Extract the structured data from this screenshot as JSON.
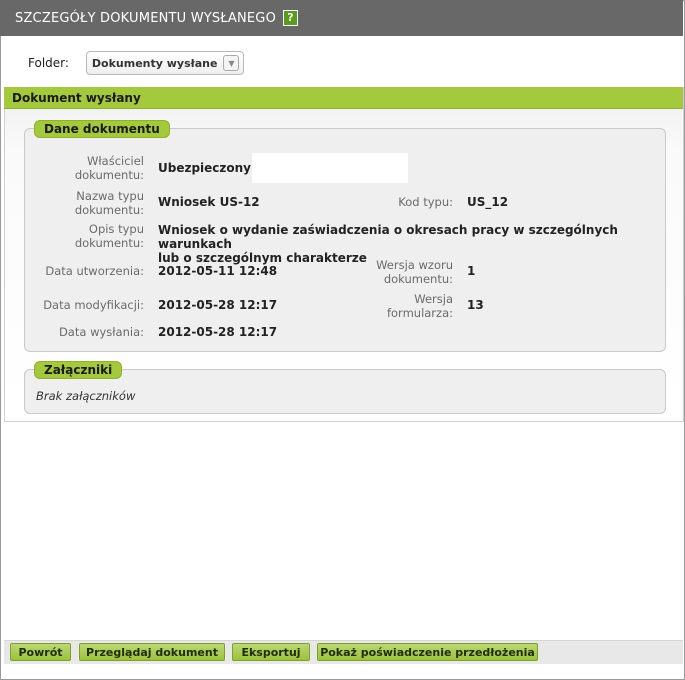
{
  "window": {
    "title": "SZCZEGÓŁY DOKUMENTU WYSŁANEGO",
    "help_label": "?"
  },
  "folder": {
    "label": "Folder:",
    "selected": "Dokumenty wysłane"
  },
  "panel": {
    "title": "Dokument wysłany"
  },
  "document_data": {
    "legend": "Dane dokumentu",
    "owner_label_1": "Właściciel",
    "owner_label_2": "dokumentu:",
    "owner_value": "Ubezpieczony -",
    "type_name_label_1": "Nazwa typu",
    "type_name_label_2": "dokumentu:",
    "type_name_value": "Wniosek US-12",
    "type_code_label": "Kod typu:",
    "type_code_value": "US_12",
    "type_desc_label_1": "Opis typu",
    "type_desc_label_2": "dokumentu:",
    "type_desc_value_1": "Wniosek o wydanie zaświadczenia o okresach pracy w szczególnych warunkach",
    "type_desc_value_2": "lub o szczególnym charakterze",
    "created_label": "Data utworzenia:",
    "created_value": "2012-05-11 12:48",
    "template_version_label_1": "Wersja wzoru",
    "template_version_label_2": "dokumentu:",
    "template_version_value": "1",
    "modified_label": "Data modyfikacji:",
    "modified_value": "2012-05-28 12:17",
    "form_version_label_1": "Wersja",
    "form_version_label_2": "formularza:",
    "form_version_value": "13",
    "sent_label": "Data wysłania:",
    "sent_value": "2012-05-28 12:17"
  },
  "attachments": {
    "legend": "Załączniki",
    "empty_text": "Brak załączników"
  },
  "buttons": {
    "back": "Powrót",
    "view": "Przeglądaj dokument",
    "export": "Eksportuj",
    "show_certificate": "Pokaż poświadczenie przedłożenia"
  },
  "colors": {
    "titlebar": "#686868",
    "accent_green": "#a4c93c",
    "help_green": "#5a9a1e"
  }
}
